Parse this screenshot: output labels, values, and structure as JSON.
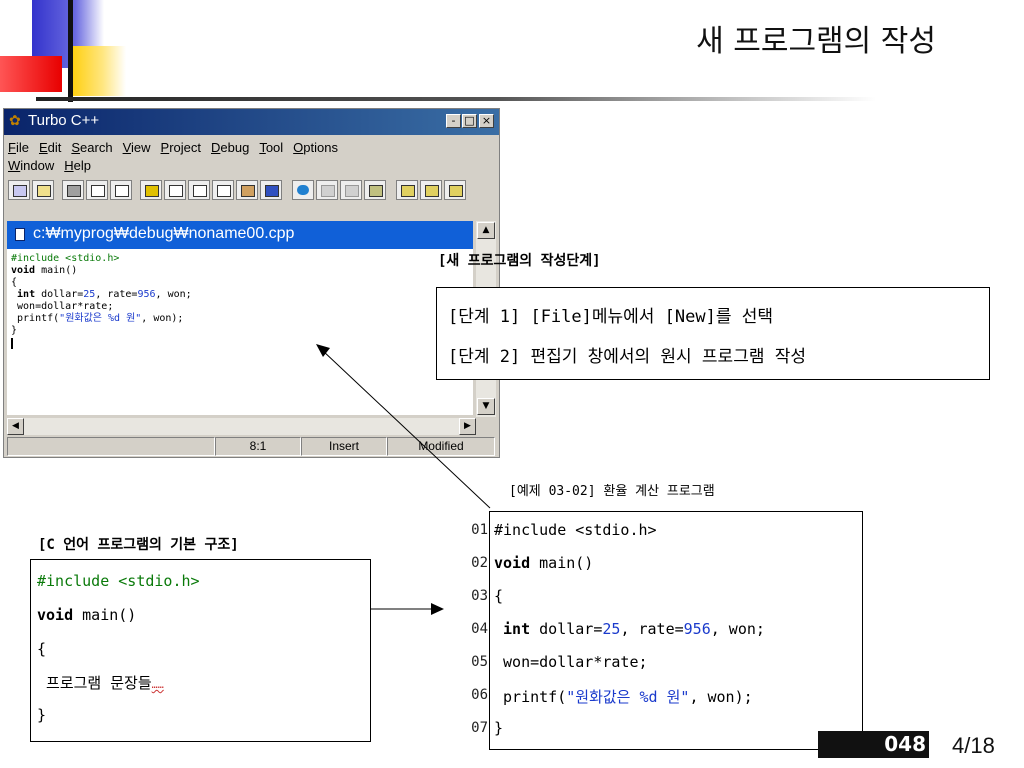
{
  "slide": {
    "title": "새 프로그램의 작성",
    "page_number": "4/18",
    "badge_text": "048"
  },
  "window": {
    "title": "Turbo C++",
    "controls": [
      "-",
      "□",
      "×"
    ],
    "menu": [
      "File",
      "Edit",
      "Search",
      "View",
      "Project",
      "Debug",
      "Tool",
      "Options",
      "Window",
      "Help"
    ],
    "document_path": "c:₩myprog₩debug₩noname00.cpp",
    "code_lines": [
      {
        "pp": "#include <stdio.h>"
      },
      {
        "kw": "void",
        "text": " main()"
      },
      {
        "text": "{"
      },
      {
        "pre": " ",
        "kw": "int",
        "text": " dollar=",
        "num1": "25",
        "text2": ", rate=",
        "num2": "956",
        "text3": ", won;"
      },
      {
        "text": " won=dollar*rate;"
      },
      {
        "text": " printf(",
        "str": "\"원화값은 %d 원\"",
        "text2": ", won);"
      },
      {
        "text": "}"
      }
    ],
    "status": {
      "position": "8:1",
      "mode": "Insert",
      "state": "Modified"
    },
    "icons": [
      "app-icon",
      "new-icon",
      "open-icon",
      "save-icon",
      "compile-icon",
      "make-icon",
      "run-icon",
      "step-icon",
      "undo-icon",
      "cut-icon",
      "copy-icon",
      "paste-icon",
      "find-icon",
      "replace-icon"
    ]
  },
  "steps": {
    "heading": "[새 프로그램의 작성단계]",
    "items": [
      "[단계 1] [File]메뉴에서 [New]를 선택",
      "[단계 2] 편집기 창에서의 원시 프로그램 작성"
    ]
  },
  "structure": {
    "heading": "[C 언어 프로그램의 기본 구조]",
    "lines": {
      "include": "#include <stdio.h>",
      "void_kw": "void",
      "main": " main()",
      "open": "{",
      "body": " 프로그램 문장들",
      "dots": "……",
      "close": "}"
    }
  },
  "example": {
    "caption": "[예제 03-02] 환율 계산 프로그램",
    "line_numbers": [
      "01",
      "02",
      "03",
      "04",
      "05",
      "06",
      "07"
    ],
    "lines": {
      "l1": "#include <stdio.h>",
      "l2_kw": "void",
      "l2": " main()",
      "l3": "{",
      "l4_pre": " ",
      "l4_kw": "int",
      "l4_a": " dollar=",
      "l4_n1": "25",
      "l4_b": ", rate=",
      "l4_n2": "956",
      "l4_c": ", won;",
      "l5": " won=dollar*rate;",
      "l6_a": " printf(",
      "l6_str": "\"원화값은 %d 원\"",
      "l6_b": ", won);",
      "l7": "}"
    }
  },
  "colors": {
    "title_bar": "#0a246a",
    "doc_header": "#1060d8",
    "preprocessor": "#0a7a0a",
    "literal": "#1a3acc"
  }
}
